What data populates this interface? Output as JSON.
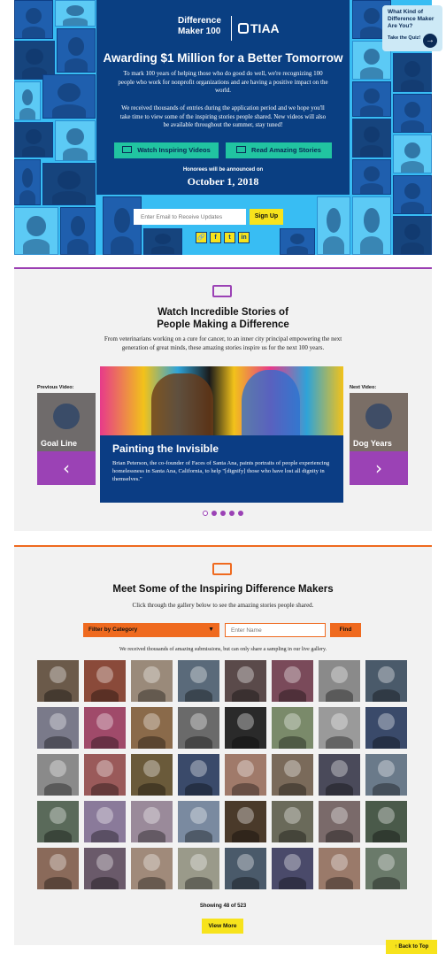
{
  "hero": {
    "brand_left": "Difference Maker 100",
    "brand_right": "TIAA",
    "title": "Awarding $1 Million for a Better Tomorrow",
    "p1": "To mark 100 years of helping those who do good do well, we're recognizing 100 people who work for nonprofit organizations and are having a positive impact on the world.",
    "p2": "We received thousands of entries during the application period and we hope you'll take time to view some of the inspiring stories people shared. New videos will also be available throughout the summer, stay tuned!",
    "btn_videos": "Watch Inspiring Videos",
    "btn_stories": "Read Amazing Stories",
    "announce_label": "Honorees will be announced on",
    "announce_date": "October 1, 2018",
    "email_placeholder": "Enter Email to Receive Updates",
    "signup": "Sign Up",
    "social": [
      "🔗",
      "f",
      "t",
      "in"
    ],
    "accent": "#38bdf3",
    "panel_color": "#0a3f82"
  },
  "quiz": {
    "title": "What Kind of Difference Maker Are You?",
    "link": "Take the Quiz!"
  },
  "videos": {
    "title_line1": "Watch Incredible Stories of",
    "title_line2": "People Making a Difference",
    "subtitle": "From veterinarians working on a cure for cancer, to an inner city principal empowering the next generation of great minds, these amazing stories inspire us for the next 100 years.",
    "prev_label": "Previous Video:",
    "next_label": "Next Video:",
    "prev_name": "Goal Line",
    "next_name": "Dog Years",
    "feature_title": "Painting the Invisible",
    "feature_desc": "Brian Peterson, the co-founder of Faces of Santa Ana, paints portraits of people experiencing homelessness in Santa Ana, California, to help \"[dignify] those who have lost all dignity in themselves.\"",
    "accent": "#9b42b5"
  },
  "gallery": {
    "title": "Meet Some of the Inspiring Difference Makers",
    "subtitle": "Click through the gallery below to see the amazing stories people shared.",
    "filter_label": "Filter by Category",
    "name_placeholder": "Enter Name",
    "find": "Find",
    "note": "We received thousands of amazing submissions, but can only share a sampling in our live gallery.",
    "showing": "Showing 48 of 523",
    "view_more": "View More",
    "accent": "#ef6a1f",
    "photo_colors": [
      "#6b5a4a",
      "#8a4a3a",
      "#9a8a7a",
      "#5a6a7a",
      "#5a4a4a",
      "#7a4a5a",
      "#8a8a8a",
      "#4a5a6a",
      "#7a7a8a",
      "#a04a6a",
      "#8a6a4a",
      "#6a6a6a",
      "#2a2a2a",
      "#7a8a6a",
      "#9a9a9a",
      "#3a4a6a",
      "#8a8a8a",
      "#9a5a5a",
      "#6a5a3a",
      "#3a4a6a",
      "#a07a6a",
      "#7a6a5a",
      "#4a4a5a",
      "#6a7a8a",
      "#5a6a5a",
      "#8a7a9a",
      "#9a8a9a",
      "#7a8aa0",
      "#4a3a2a",
      "#6a6a5a",
      "#7a6a6a",
      "#4a5a4a",
      "#8a6a5a",
      "#6a5a6a",
      "#a08a7a",
      "#9a9a8a",
      "#4a5a6a",
      "#4a4a6a",
      "#9a7a6a",
      "#6a7a6a"
    ]
  },
  "footer": {
    "back_to_top": "Back to Top"
  }
}
